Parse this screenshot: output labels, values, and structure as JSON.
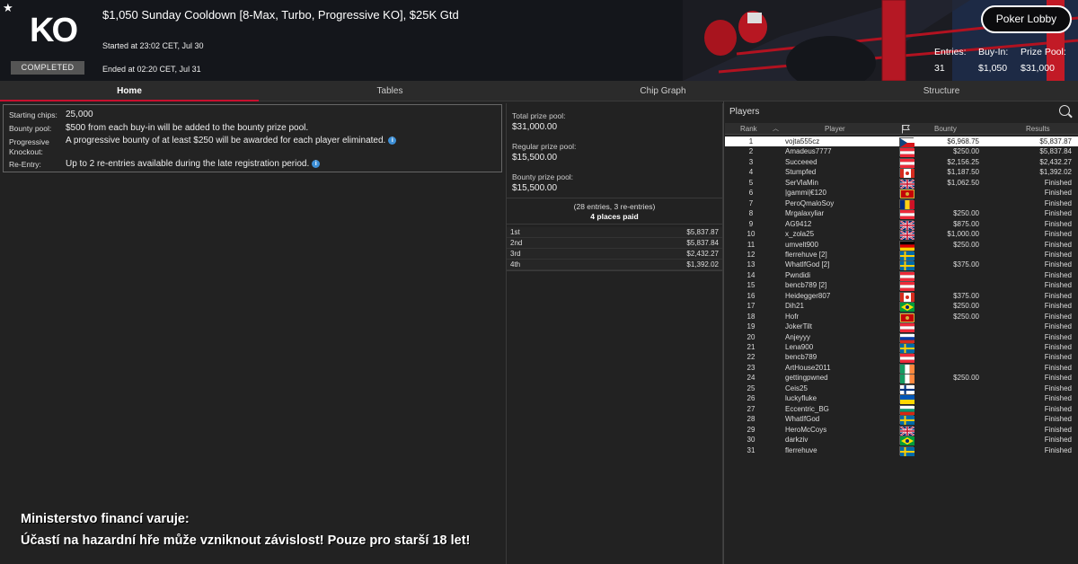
{
  "header": {
    "star": "★",
    "logo": "KO",
    "status": "COMPLETED",
    "title": "$1,050 Sunday Cooldown [8-Max, Turbo, Progressive KO], $25K Gtd",
    "started": "Started at 23:02 CET, Jul 30",
    "ended": "Ended at 02:20 CET, Jul 31",
    "lobby_button": "Poker Lobby",
    "entries_label": "Entries:",
    "entries_value": "31",
    "buyin_label": "Buy-In:",
    "buyin_value": "$1,050",
    "prizepool_label": "Prize Pool:",
    "prizepool_value": "$31,000"
  },
  "tabs": [
    "Home",
    "Tables",
    "Chip Graph",
    "Structure"
  ],
  "info": {
    "starting_label": "Starting chips:",
    "starting_value": "25,000",
    "bounty_label": "Bounty pool:",
    "bounty_value": "$500 from each buy-in will be added to the bounty prize pool.",
    "pko_label1": "Progressive",
    "pko_label2": "Knockout:",
    "pko_value": "A progressive bounty of at least $250 will be awarded for each player eliminated.",
    "reentry_label": "Re-Entry:",
    "reentry_value": "Up to 2 re-entries available during the late registration period.",
    "info_icon": "i"
  },
  "prize": {
    "total_label": "Total prize pool:",
    "total_value": "$31,000.00",
    "regular_label": "Regular prize pool:",
    "regular_value": "$15,500.00",
    "bounty_label": "Bounty prize pool:",
    "bounty_value": "$15,500.00",
    "entries_note": "(28 entries, 3 re-entries)",
    "places_note": "4 places paid",
    "places": [
      {
        "place": "1st",
        "amount": "$5,837.87"
      },
      {
        "place": "2nd",
        "amount": "$5,837.84"
      },
      {
        "place": "3rd",
        "amount": "$2,432.27"
      },
      {
        "place": "4th",
        "amount": "$1,392.02"
      }
    ]
  },
  "players": {
    "title": "Players",
    "col_rank": "Rank",
    "col_player": "Player",
    "col_bounty": "Bounty",
    "col_results": "Results",
    "rows": [
      {
        "rank": "1",
        "name": "vojta555cz",
        "flag": "cz",
        "bounty": "$6,968.75",
        "result": "$5,837.87"
      },
      {
        "rank": "2",
        "name": "Amadeus7777",
        "flag": "at",
        "bounty": "$250.00",
        "result": "$5,837.84"
      },
      {
        "rank": "3",
        "name": "Succeeed",
        "flag": "at",
        "bounty": "$2,156.25",
        "result": "$2,432.27"
      },
      {
        "rank": "4",
        "name": "Stumpfed",
        "flag": "ca",
        "bounty": "$1,187.50",
        "result": "$1,392.02"
      },
      {
        "rank": "5",
        "name": "SerVlaMin",
        "flag": "gb",
        "bounty": "$1,062.50",
        "result": "Finished"
      },
      {
        "rank": "6",
        "name": "|gammi|€120",
        "flag": "me",
        "bounty": "",
        "result": "Finished"
      },
      {
        "rank": "7",
        "name": "PeroQmaloSoy",
        "flag": "ro",
        "bounty": "",
        "result": "Finished"
      },
      {
        "rank": "8",
        "name": "Mrgalaxyliar",
        "flag": "at",
        "bounty": "$250.00",
        "result": "Finished"
      },
      {
        "rank": "9",
        "name": "AG9412",
        "flag": "gb",
        "bounty": "$875.00",
        "result": "Finished"
      },
      {
        "rank": "10",
        "name": "x_zola25",
        "flag": "gb",
        "bounty": "$1,000.00",
        "result": "Finished"
      },
      {
        "rank": "11",
        "name": "umvelt900",
        "flag": "de",
        "bounty": "$250.00",
        "result": "Finished"
      },
      {
        "rank": "12",
        "name": "flerrehuve [2]",
        "flag": "se",
        "bounty": "",
        "result": "Finished"
      },
      {
        "rank": "13",
        "name": "WhatIfGod [2]",
        "flag": "se",
        "bounty": "$375.00",
        "result": "Finished"
      },
      {
        "rank": "14",
        "name": "Pwndidi",
        "flag": "at",
        "bounty": "",
        "result": "Finished"
      },
      {
        "rank": "15",
        "name": "bencb789 [2]",
        "flag": "at",
        "bounty": "",
        "result": "Finished"
      },
      {
        "rank": "16",
        "name": "Heidegger807",
        "flag": "ca",
        "bounty": "$375.00",
        "result": "Finished"
      },
      {
        "rank": "17",
        "name": "Dih21",
        "flag": "br",
        "bounty": "$250.00",
        "result": "Finished"
      },
      {
        "rank": "18",
        "name": "Hofr",
        "flag": "me",
        "bounty": "$250.00",
        "result": "Finished"
      },
      {
        "rank": "19",
        "name": "JokerTilt",
        "flag": "at",
        "bounty": "",
        "result": "Finished"
      },
      {
        "rank": "20",
        "name": "Anjeyyy",
        "flag": "ru",
        "bounty": "",
        "result": "Finished"
      },
      {
        "rank": "21",
        "name": "Lena900",
        "flag": "se",
        "bounty": "",
        "result": "Finished"
      },
      {
        "rank": "22",
        "name": "bencb789",
        "flag": "at",
        "bounty": "",
        "result": "Finished"
      },
      {
        "rank": "23",
        "name": "ArtHouse2011",
        "flag": "ie",
        "bounty": "",
        "result": "Finished"
      },
      {
        "rank": "24",
        "name": "gettingpwned",
        "flag": "ie",
        "bounty": "$250.00",
        "result": "Finished"
      },
      {
        "rank": "25",
        "name": "Ceis25",
        "flag": "fi",
        "bounty": "",
        "result": "Finished"
      },
      {
        "rank": "26",
        "name": "luckyfluke",
        "flag": "ua",
        "bounty": "",
        "result": "Finished"
      },
      {
        "rank": "27",
        "name": "Eccentric_BG",
        "flag": "bg",
        "bounty": "",
        "result": "Finished"
      },
      {
        "rank": "28",
        "name": "WhatIfGod",
        "flag": "se",
        "bounty": "",
        "result": "Finished"
      },
      {
        "rank": "29",
        "name": "HeroMcCoys",
        "flag": "gb",
        "bounty": "",
        "result": "Finished"
      },
      {
        "rank": "30",
        "name": "darkziv",
        "flag": "br",
        "bounty": "",
        "result": "Finished"
      },
      {
        "rank": "31",
        "name": "flerrehuve",
        "flag": "se",
        "bounty": "",
        "result": "Finished"
      }
    ]
  },
  "warning": {
    "line1": "Ministerstvo financí varuje:",
    "line2": "Účastí na hazardní hře může vzniknout závislost! Pouze pro starší 18 let!"
  },
  "colors": {
    "accent": "#c8102e",
    "info_icon": "#3d8fd6"
  }
}
